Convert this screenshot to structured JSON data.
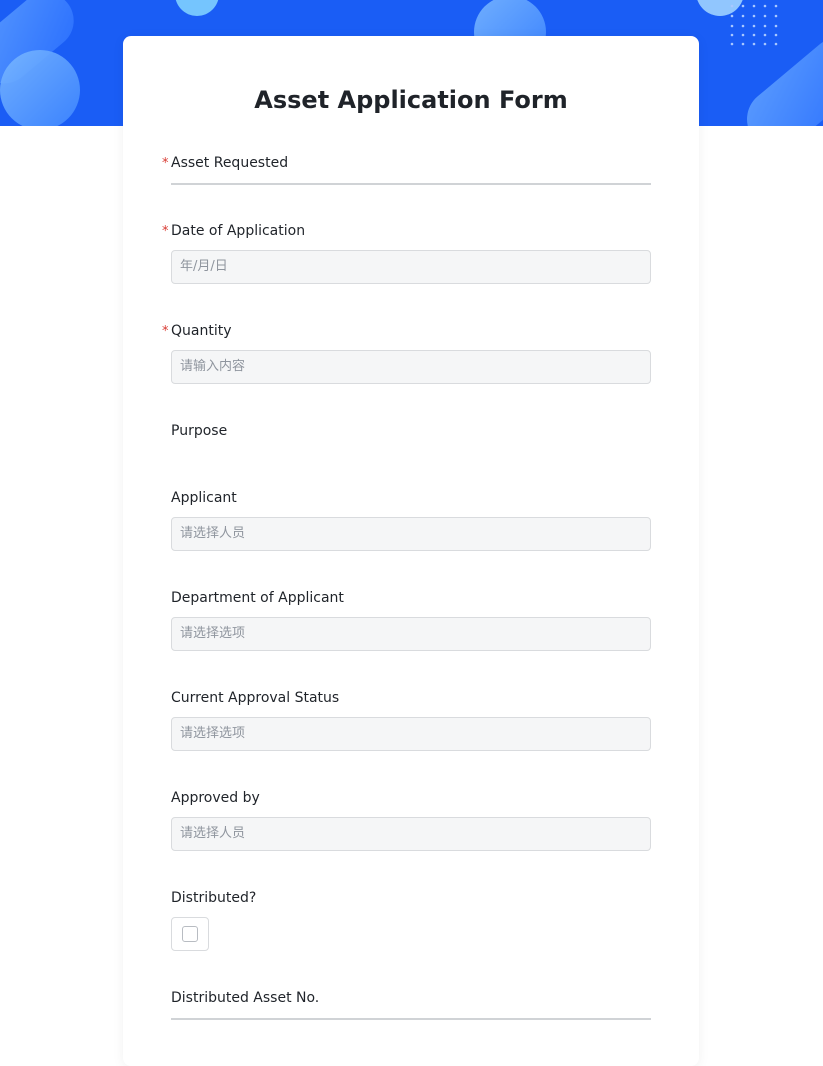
{
  "form": {
    "title": "Asset Application Form",
    "required_mark": "*",
    "fields": [
      {
        "label": "Asset Requested",
        "required": true,
        "type": "underline-text",
        "value": ""
      },
      {
        "label": "Date of Application",
        "required": true,
        "type": "date",
        "placeholder": "年/月/日"
      },
      {
        "label": "Quantity",
        "required": true,
        "type": "number",
        "placeholder": "请输入内容"
      },
      {
        "label": "Purpose",
        "required": false,
        "type": "text",
        "value": ""
      },
      {
        "label": "Applicant",
        "required": false,
        "type": "person-select",
        "placeholder": "请选择人员"
      },
      {
        "label": "Department of Applicant",
        "required": false,
        "type": "select",
        "placeholder": "请选择选项"
      },
      {
        "label": "Current Approval Status",
        "required": false,
        "type": "select",
        "placeholder": "请选择选项"
      },
      {
        "label": "Approved by",
        "required": false,
        "type": "person-select",
        "placeholder": "请选择人员"
      },
      {
        "label": "Distributed?",
        "required": false,
        "type": "checkbox",
        "checked": false
      },
      {
        "label": "Distributed Asset No.",
        "required": false,
        "type": "underline-text",
        "value": ""
      }
    ]
  },
  "theme": {
    "banner_color": "#1a5df5",
    "required_color": "#d83931",
    "input_background": "#f5f6f7",
    "placeholder_color": "#8f959e"
  }
}
